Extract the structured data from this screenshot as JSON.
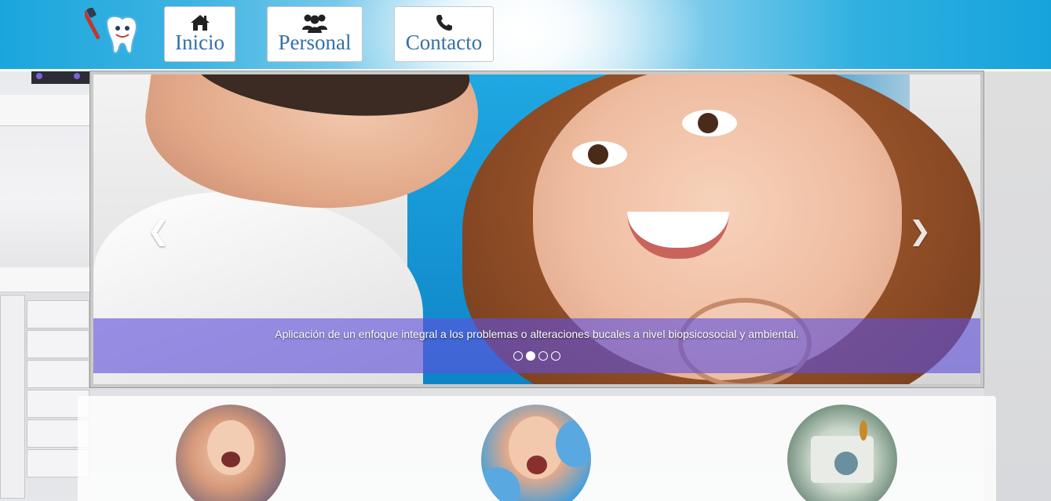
{
  "nav": {
    "items": [
      {
        "label": "Inicio",
        "icon": "home-icon"
      },
      {
        "label": "Personal",
        "icon": "users-icon"
      },
      {
        "label": "Contacto",
        "icon": "phone-icon"
      }
    ]
  },
  "carousel": {
    "caption": "Aplicación de un enfoque integral a los problemas o alteraciones bucales a nivel biopsicosocial y ambiental.",
    "slides_count": 4,
    "active_slide": 2,
    "prev_icon": "chevron-left-icon",
    "next_icon": "chevron-right-icon"
  },
  "colors": {
    "header_blue": "#1aa6dc",
    "nav_text": "#3470a8",
    "caption_bg": "#5f50dc"
  }
}
